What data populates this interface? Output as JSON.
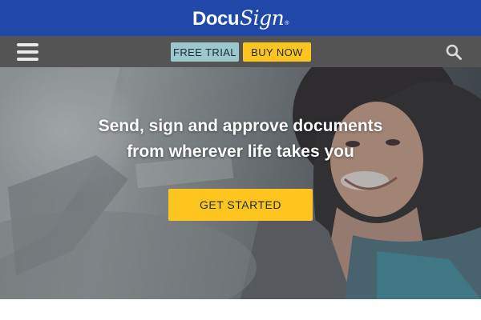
{
  "header": {
    "logo_main": "Docu",
    "logo_script": "Sign",
    "logo_mark": "®"
  },
  "nav": {
    "menu_icon": "hamburger-menu-icon",
    "search_icon": "search-icon",
    "free_trial_label": "FREE TRIAL",
    "buy_now_label": "BUY NOW"
  },
  "hero": {
    "headline_line1": "Send, sign and approve documents",
    "headline_line2": "from wherever life takes you",
    "cta_label": "GET STARTED"
  },
  "colors": {
    "brand_blue": "#1f48a8",
    "nav_gray": "#545454",
    "trial_teal": "#9cc8cc",
    "cta_yellow": "#ffc51f"
  }
}
